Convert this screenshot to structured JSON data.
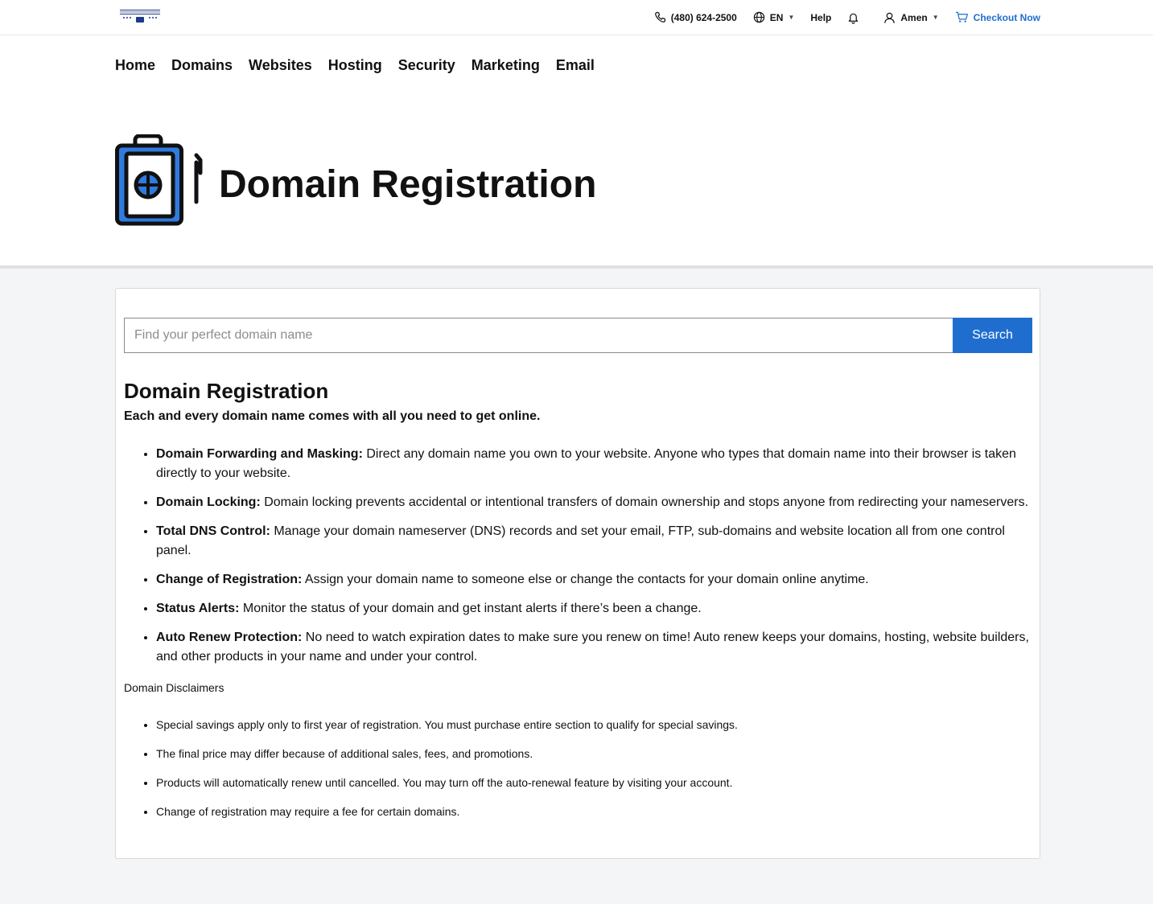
{
  "topbar": {
    "phone": "(480) 624-2500",
    "language": "EN",
    "help": "Help",
    "user": "Amen",
    "checkout": "Checkout Now"
  },
  "nav": [
    "Home",
    "Domains",
    "Websites",
    "Hosting",
    "Security",
    "Marketing",
    "Email"
  ],
  "hero": {
    "title": "Domain Registration"
  },
  "search": {
    "placeholder": "Find your perfect domain name",
    "button": "Search"
  },
  "content": {
    "heading": "Domain Registration",
    "subtitle": "Each and every domain name comes with all you need to get online.",
    "features": [
      {
        "title": "Domain Forwarding and Masking:",
        "text": " Direct any domain name you own to your website. Anyone who types that domain name into their browser is taken directly to your website."
      },
      {
        "title": "Domain Locking:",
        "text": " Domain locking prevents accidental or intentional transfers of domain ownership and stops anyone from redirecting your nameservers."
      },
      {
        "title": "Total DNS Control:",
        "text": " Manage your domain nameserver (DNS) records and set your email, FTP, sub-domains and website location all from one control panel."
      },
      {
        "title": "Change of Registration:",
        "text": " Assign your domain name to someone else or change the contacts for your domain online anytime."
      },
      {
        "title": "Status Alerts:",
        "text": " Monitor the status of your domain and get instant alerts if there’s been a change."
      },
      {
        "title": "Auto Renew Protection:",
        "text": " No need to watch expiration dates to make sure you renew on time! Auto renew keeps your domains, hosting, website builders, and other products in your name and under your control."
      }
    ],
    "disclaimers_title": "Domain Disclaimers",
    "disclaimers": [
      "Special savings apply only to first year of registration. You must purchase entire section to qualify for special savings.",
      "The final price may differ because of additional sales, fees, and promotions.",
      "Products will automatically renew until cancelled. You may turn off the auto-renewal feature by visiting your account.",
      "Change of registration may require a fee for certain domains."
    ]
  },
  "colors": {
    "accent": "#1f6ecf",
    "page_bg": "#f4f5f6"
  }
}
